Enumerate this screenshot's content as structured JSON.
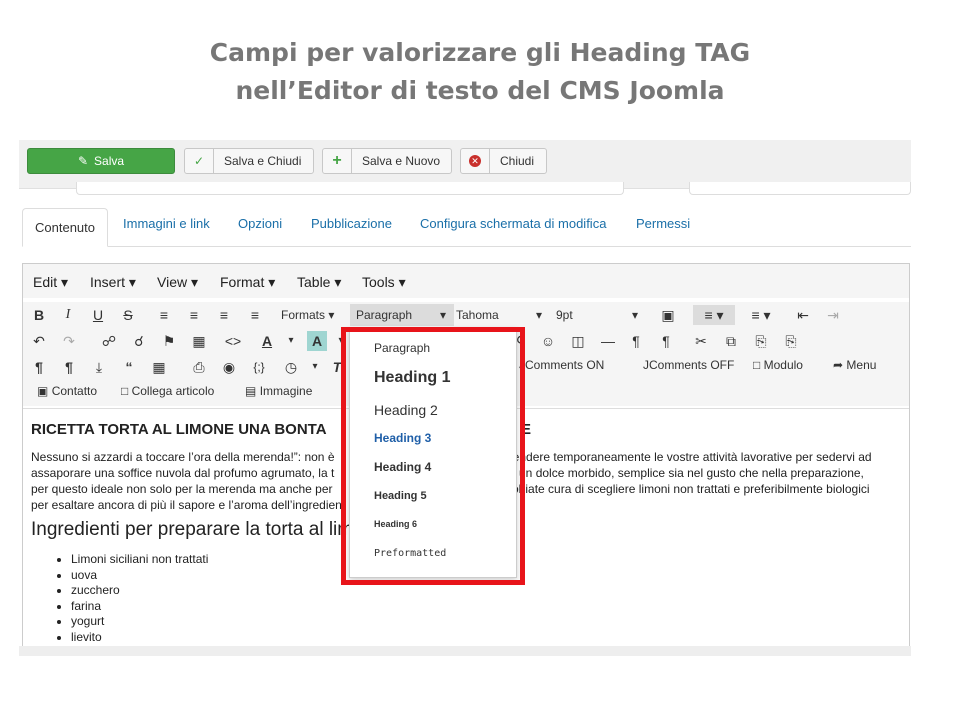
{
  "slide": {
    "title_line1": "Campi per valorizzare gli Heading TAG",
    "title_line2": "nell’Editor di testo del CMS Joomla"
  },
  "toolbar": {
    "save_label": "Salva",
    "save_close_label": "Salva e Chiudi",
    "save_new_label": "Salva e Nuovo",
    "close_label": "Chiudi"
  },
  "tabs": [
    "Contenuto",
    "Immagini e link",
    "Opzioni",
    "Pubblicazione",
    "Configura schermata di modifica",
    "Permessi"
  ],
  "menubar": [
    "Edit",
    "Insert",
    "View",
    "Format",
    "Table",
    "Tools"
  ],
  "format_controls": {
    "formats_label": "Formats",
    "block_value": "Paragraph",
    "font_value": "Tahoma",
    "size_value": "9pt"
  },
  "plugin_buttons": {
    "jcomments_on": "JComments ON",
    "jcomments_off": "JComments OFF",
    "modulo": "Modulo",
    "menu": "Menu",
    "contatto": "Contatto",
    "collega_articolo": "Collega articolo",
    "immagine": "Immagine"
  },
  "block_dropdown": {
    "items": [
      "Paragraph",
      "Heading 1",
      "Heading 2",
      "Heading 3",
      "Heading 4",
      "Heading 5",
      "Heading 6",
      "Preformatted"
    ]
  },
  "content": {
    "heading": "RICETTA TORTA AL LIMONE UNA BONTA",
    "heading_tail": "E",
    "para_left": [
      "Nessuno si azzardi a toccare l’ora della merenda!”: non è",
      "assaporare una soffice nuvola dal profumo agrumato, la t",
      "per questo ideale non solo per la merenda ma anche per",
      "per esaltare ancora di più il sapore e l’aroma dell’ingredient"
    ],
    "para_right": [
      "pendere temporaneamente le vostre attività lavorative per sedervi ad",
      "è un dolce morbido, semplice sia nel gusto che nella preparazione,",
      "obiate cura di scegliere limoni non trattati e preferibilmente biologici",
      ""
    ],
    "subheading": "Ingredienti per preparare la torta al lim",
    "ingredients": [
      "Limoni siciliani non trattati",
      "uova",
      "zucchero",
      "farina",
      "yogurt",
      "lievito"
    ]
  },
  "colors": {
    "save_green": "#46a546",
    "highlight_red": "#e8141a",
    "link_blue": "#1a6fa8",
    "heading3_blue": "#1f5fa8"
  }
}
